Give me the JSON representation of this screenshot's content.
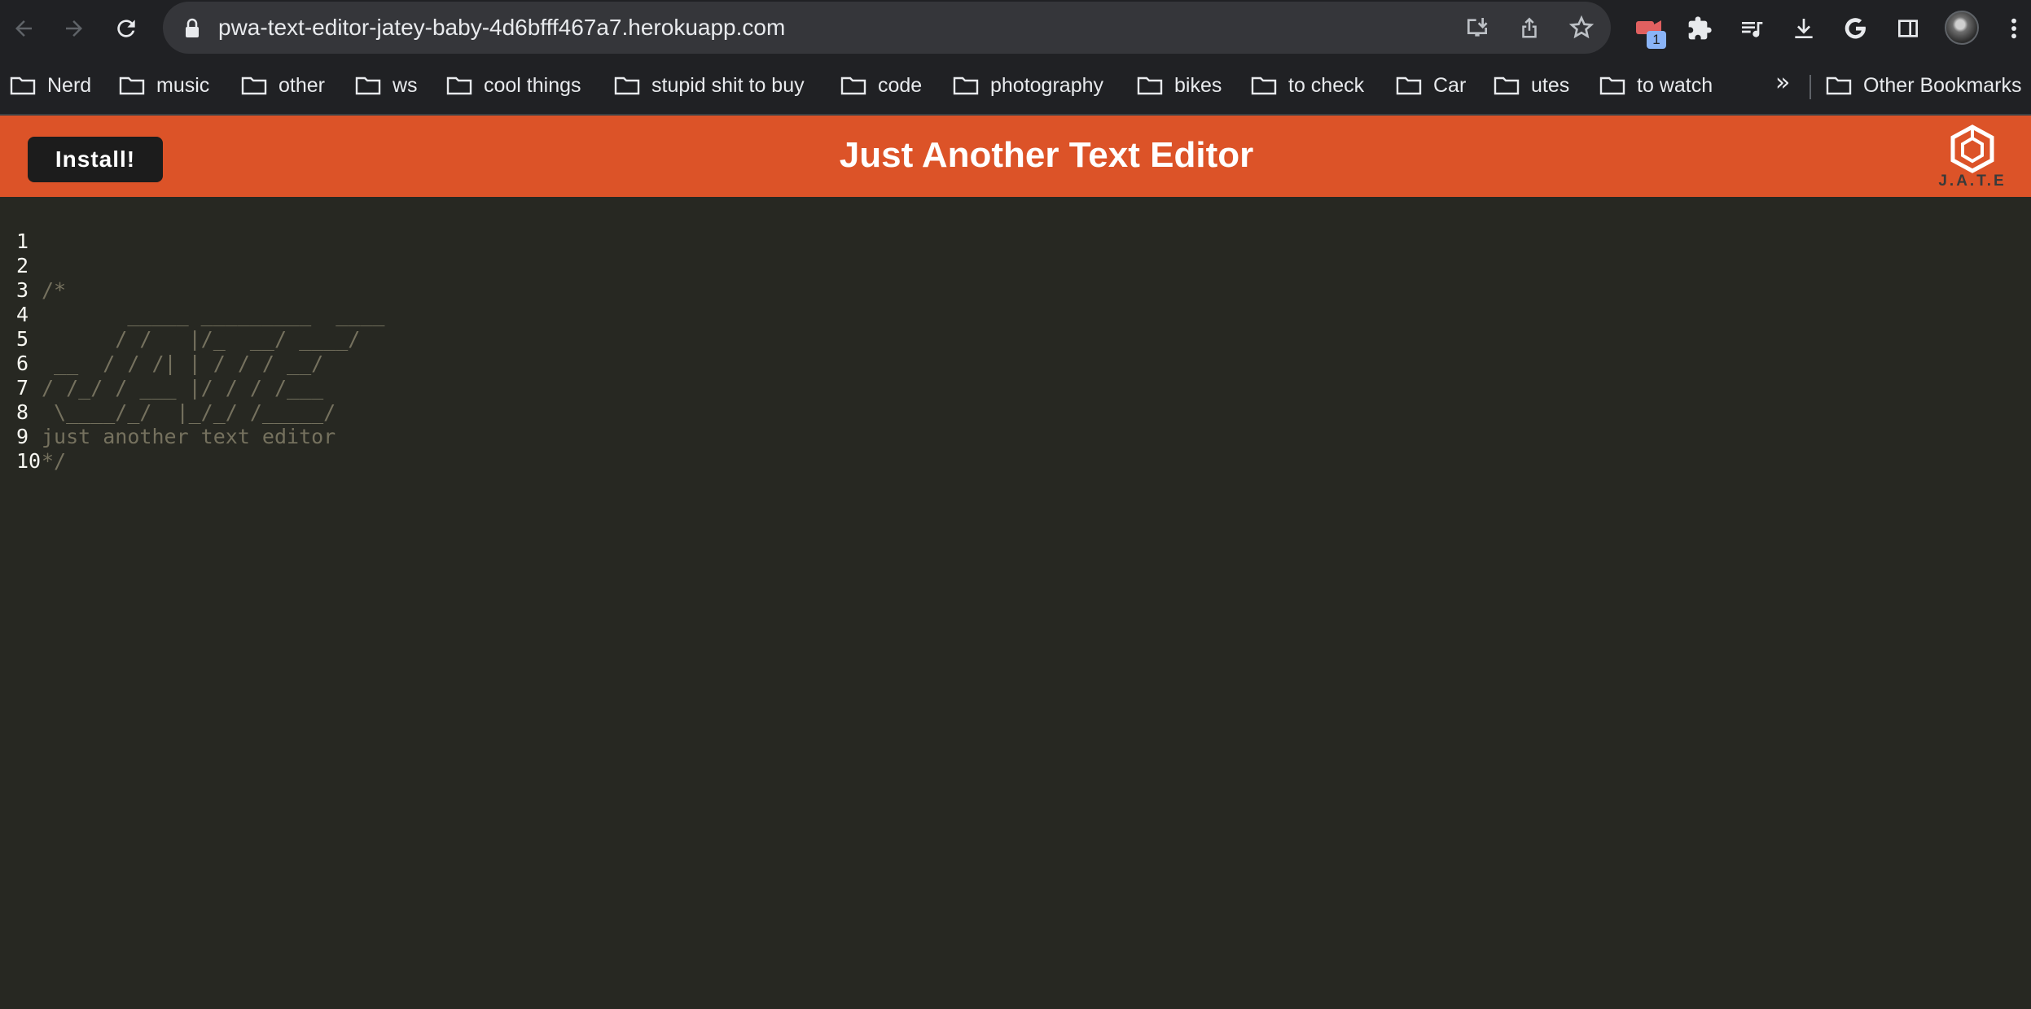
{
  "browser": {
    "url": "pwa-text-editor-jatey-baby-4d6bfff467a7.herokuapp.com",
    "extension_badge": "1",
    "bookmarks": [
      {
        "label": "Nerd"
      },
      {
        "label": "music"
      },
      {
        "label": "other"
      },
      {
        "label": "ws"
      },
      {
        "label": "cool things"
      },
      {
        "label": "stupid shit to buy"
      },
      {
        "label": "code"
      },
      {
        "label": "photography"
      },
      {
        "label": "bikes"
      },
      {
        "label": "to check"
      },
      {
        "label": "Car"
      },
      {
        "label": "utes"
      },
      {
        "label": "to watch"
      }
    ],
    "more_bookmarks": "»",
    "other_bookmarks": "Other Bookmarks"
  },
  "app": {
    "install_label": "Install!",
    "title": "Just Another Text Editor",
    "logo_text": "J.A.T.E",
    "header_color": "#dc5328"
  },
  "editor": {
    "lines": [
      {
        "num": "1",
        "text": ""
      },
      {
        "num": "2",
        "text": "/*"
      },
      {
        "num": "3",
        "text": "       _____ _________  ____"
      },
      {
        "num": "4",
        "text": "      / /   |/_  __/ ____/"
      },
      {
        "num": "5",
        "text": " __  / / /| | / / / __/"
      },
      {
        "num": "6",
        "text": "/ /_/ / ___ |/ / / /___"
      },
      {
        "num": "7",
        "text": " \\____/_/  |_/_/ /_____/"
      },
      {
        "num": "8",
        "text": "just another text editor"
      },
      {
        "num": "9",
        "text": "*/"
      },
      {
        "num": "10",
        "text": ""
      }
    ]
  }
}
